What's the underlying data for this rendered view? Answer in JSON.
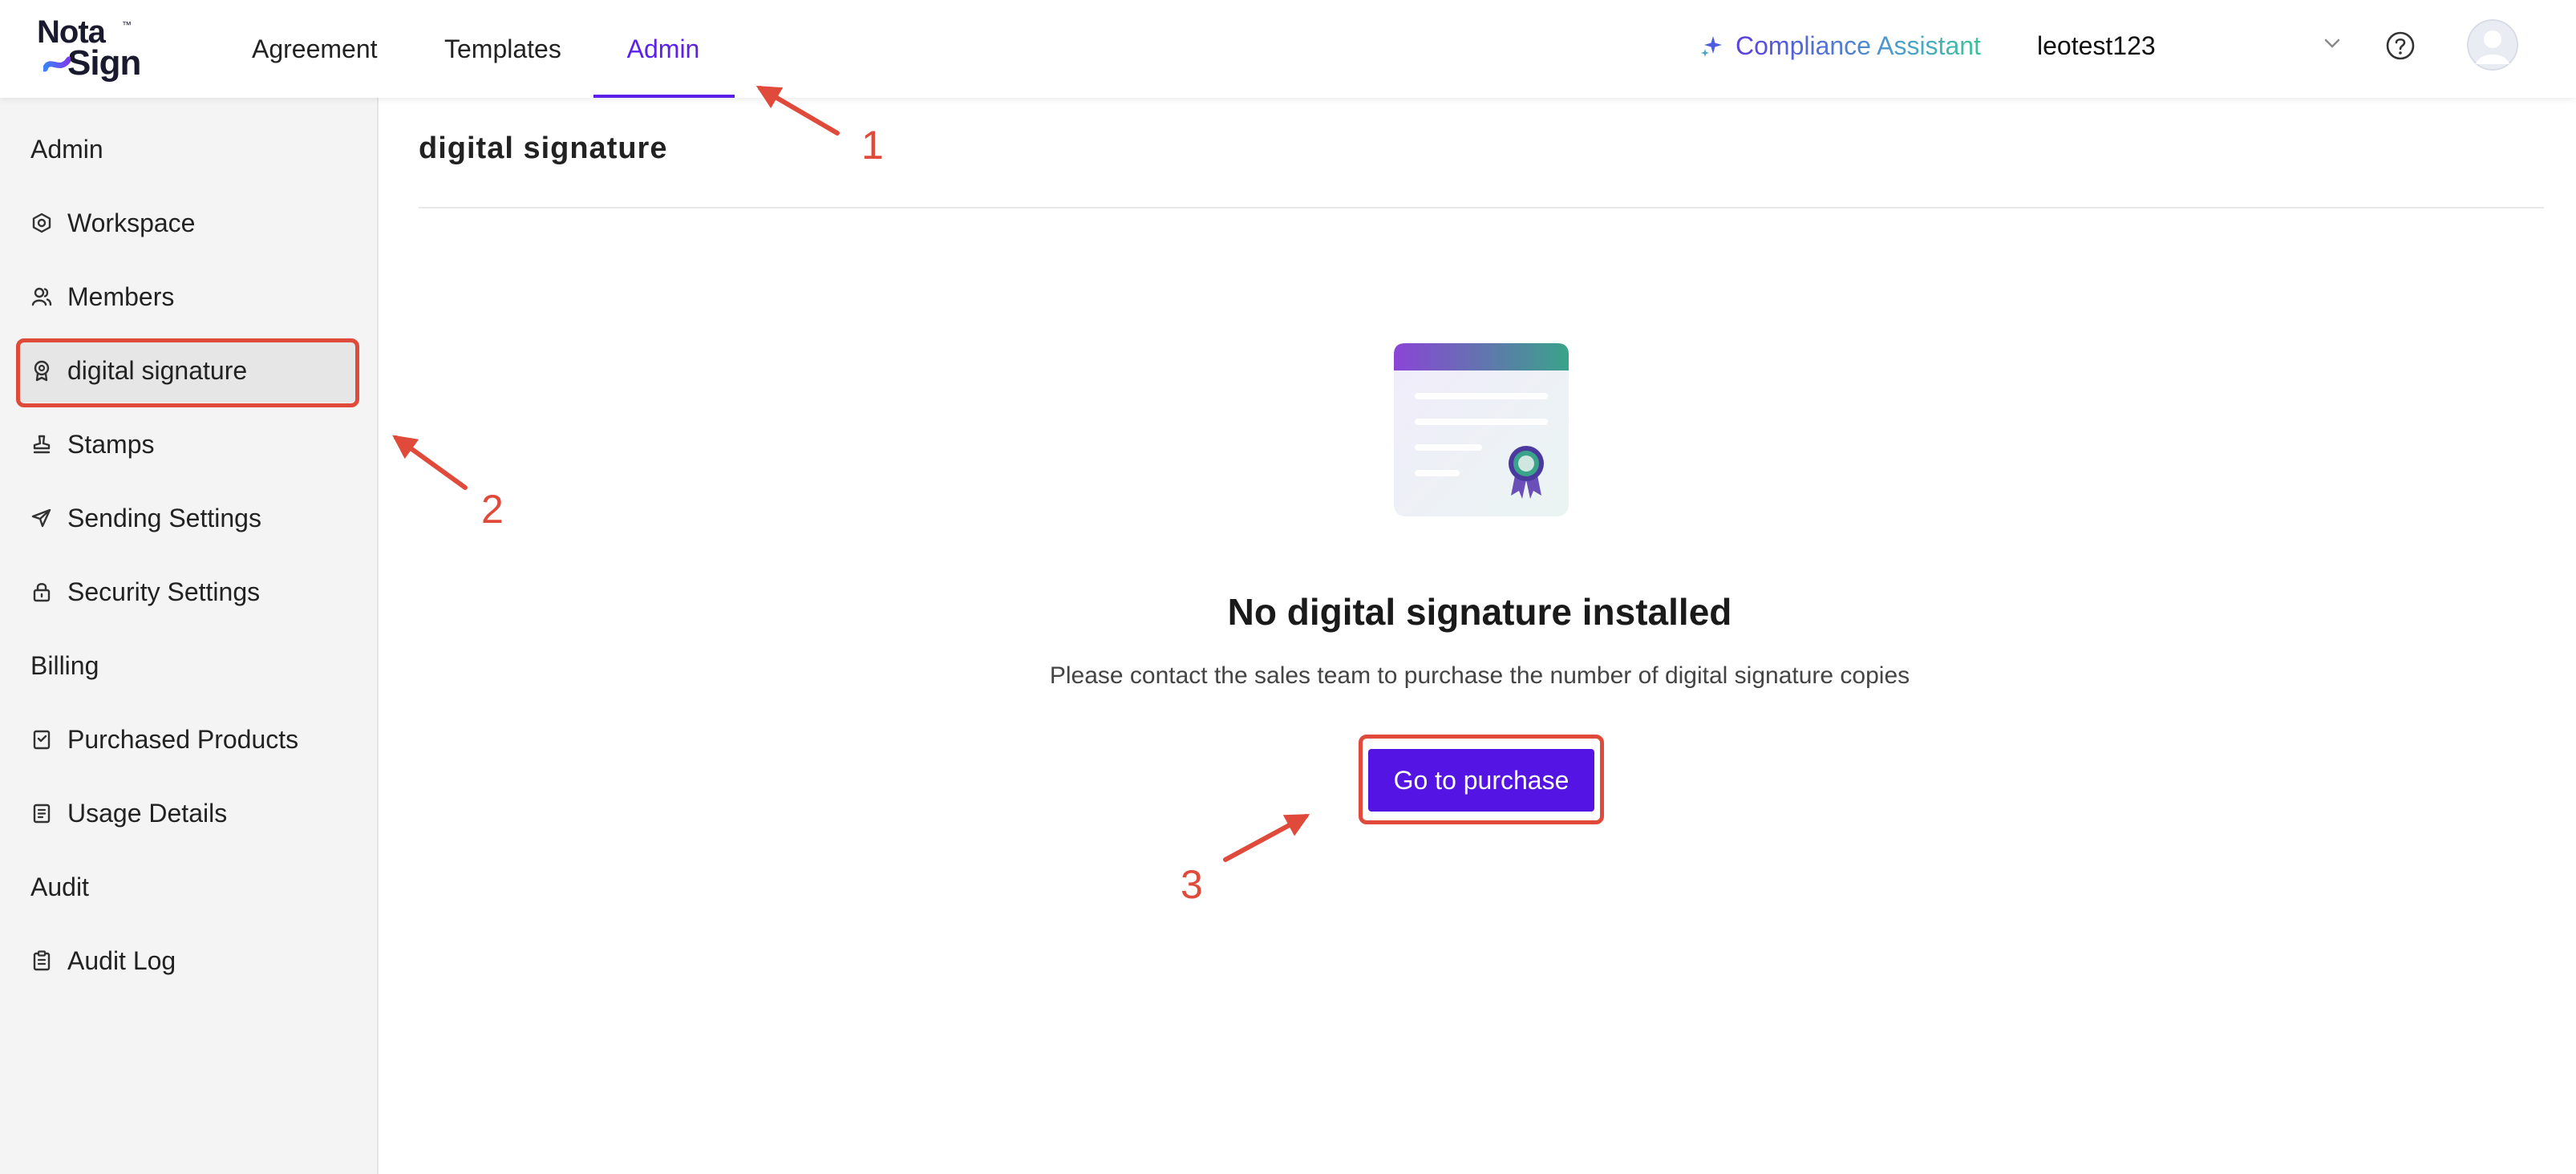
{
  "logo": {
    "line1": "Nota",
    "line2": "Sign",
    "tm": "™"
  },
  "nav": {
    "agreement": "Agreement",
    "templates": "Templates",
    "admin": "Admin"
  },
  "header": {
    "assistant": "Compliance Assistant",
    "account": "leotest123",
    "icons": [
      "sparkle-icon",
      "chevron-down-icon",
      "help-icon",
      "avatar"
    ]
  },
  "sidebar": {
    "sections": {
      "admin": "Admin",
      "billing": "Billing",
      "audit": "Audit"
    },
    "items": {
      "workspace": {
        "label": "Workspace",
        "icon": "workspace-icon"
      },
      "members": {
        "label": "Members",
        "icon": "members-icon"
      },
      "digital_signature": {
        "label": "digital signature",
        "icon": "seal-icon"
      },
      "stamps": {
        "label": "Stamps",
        "icon": "stamp-icon"
      },
      "sending_settings": {
        "label": "Sending Settings",
        "icon": "send-icon"
      },
      "security_settings": {
        "label": "Security Settings",
        "icon": "lock-icon"
      },
      "purchased_products": {
        "label": "Purchased Products",
        "icon": "product-icon"
      },
      "usage_details": {
        "label": "Usage Details",
        "icon": "document-icon"
      },
      "audit_log": {
        "label": "Audit Log",
        "icon": "clipboard-icon"
      }
    }
  },
  "main": {
    "title": "digital signature",
    "empty_title": "No digital signature installed",
    "empty_desc": "Please contact the sales team to purchase the number of digital signature copies",
    "button": "Go to purchase"
  },
  "annotations": {
    "n1": "1",
    "n2": "2",
    "n3": "3"
  },
  "colors": {
    "accent": "#5414e4",
    "annotation": "#e04a3a",
    "sidebar_bg": "#f4f4f4"
  }
}
